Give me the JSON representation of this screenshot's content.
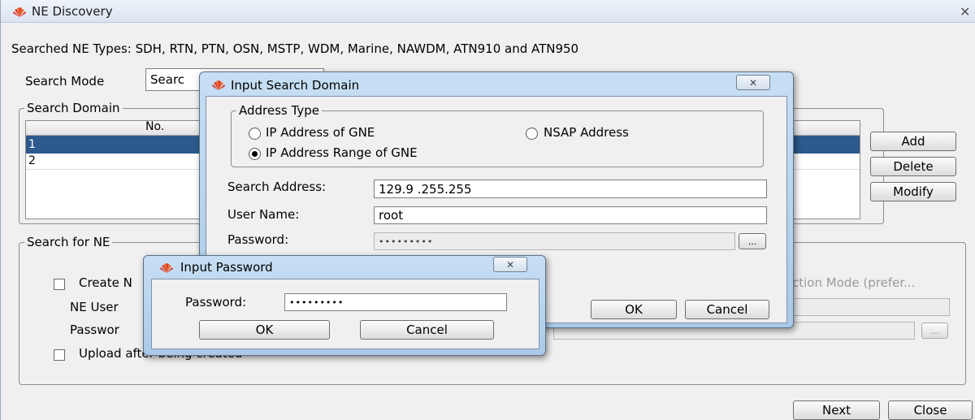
{
  "main_window": {
    "title": "NE Discovery",
    "close_glyph": "✕",
    "searched_types": "Searched NE Types: SDH, RTN, PTN, OSN, MSTP, WDM, Marine, NAWDM, ATN910 and ATN950",
    "search_mode_label": "Search Mode",
    "search_mode_value": "Searc",
    "search_domain_legend": "Search Domain",
    "table_header_no": "No.",
    "rows": [
      "1",
      "2"
    ],
    "add_label": "Add",
    "delete_label": "Delete",
    "modify_label": "Modify",
    "search_for_ne_legend": "Search for NE",
    "create_label": "Create N",
    "ne_user_label": "NE User",
    "password_label": "Passwor",
    "connection_mode_partial": "ction Mode (prefer...",
    "browse_label": "...",
    "upload_label": "Upload after being created",
    "next_label": "Next",
    "close_label": "Close"
  },
  "domain_dialog": {
    "title": "Input Search Domain",
    "close_glyph": "✕",
    "address_type_legend": "Address Type",
    "ip_gne_label": "IP Address of GNE",
    "nsap_label": "NSAP Address",
    "ip_range_label": "IP Address Range of GNE",
    "search_address_label": "Search Address:",
    "search_address_value": "129.9  .255.255",
    "user_name_label": "User Name:",
    "user_name_value": "root",
    "password_label": "Password:",
    "password_value": "•••••••••",
    "browse_label": "...",
    "ok_label": "OK",
    "cancel_label": "Cancel"
  },
  "password_dialog": {
    "title": "Input Password",
    "close_glyph": "✕",
    "password_label": "Password:",
    "password_value": "•••••••••",
    "ok_label": "OK",
    "cancel_label": "Cancel"
  },
  "colors": {
    "selected_row": "#2c5a8c",
    "title_bar": "#dde7f2",
    "win7_frame": "#b6d0ea"
  },
  "icons": {
    "app_logo": "huawei-logo-icon",
    "radio_selected": "ip-range-radio"
  }
}
